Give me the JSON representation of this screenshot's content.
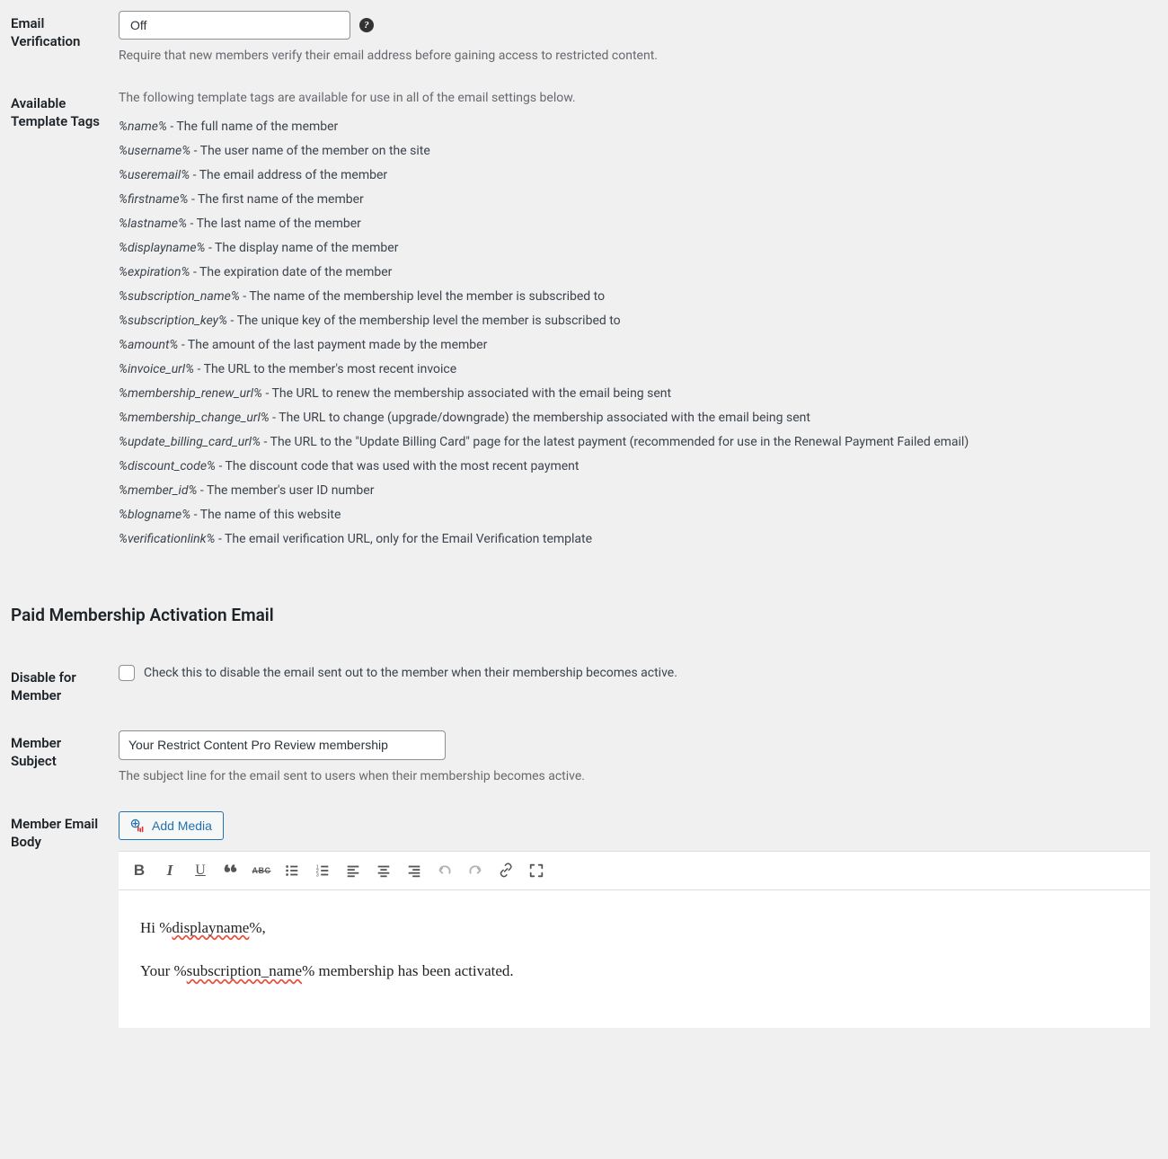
{
  "emailVerification": {
    "label": "Email Verification",
    "selected": "Off",
    "desc": "Require that new members verify their email address before gaining access to restricted content."
  },
  "templateTags": {
    "label": "Available Template Tags",
    "intro": "The following template tags are available for use in all of the email settings below.",
    "tags": [
      {
        "tag": "%name%",
        "desc": " - The full name of the member"
      },
      {
        "tag": "%username%",
        "desc": " - The user name of the member on the site"
      },
      {
        "tag": "%useremail%",
        "desc": " - The email address of the member"
      },
      {
        "tag": "%firstname%",
        "desc": " - The first name of the member"
      },
      {
        "tag": "%lastname%",
        "desc": " - The last name of the member"
      },
      {
        "tag": "%displayname%",
        "desc": " - The display name of the member"
      },
      {
        "tag": "%expiration%",
        "desc": " - The expiration date of the member"
      },
      {
        "tag": "%subscription_name%",
        "desc": " - The name of the membership level the member is subscribed to"
      },
      {
        "tag": "%subscription_key%",
        "desc": " - The unique key of the membership level the member is subscribed to"
      },
      {
        "tag": "%amount%",
        "desc": " - The amount of the last payment made by the member"
      },
      {
        "tag": "%invoice_url%",
        "desc": " - The URL to the member's most recent invoice"
      },
      {
        "tag": "%membership_renew_url%",
        "desc": " - The URL to renew the membership associated with the email being sent"
      },
      {
        "tag": "%membership_change_url%",
        "desc": " - The URL to change (upgrade/downgrade) the membership associated with the email being sent"
      },
      {
        "tag": "%update_billing_card_url%",
        "desc": " - The URL to the \"Update Billing Card\" page for the latest payment (recommended for use in the Renewal Payment Failed email)"
      },
      {
        "tag": "%discount_code%",
        "desc": " - The discount code that was used with the most recent payment"
      },
      {
        "tag": "%member_id%",
        "desc": " - The member's user ID number"
      },
      {
        "tag": "%blogname%",
        "desc": " - The name of this website"
      },
      {
        "tag": "%verificationlink%",
        "desc": " - The email verification URL, only for the Email Verification template"
      }
    ]
  },
  "sectionHeading": "Paid Membership Activation Email",
  "disableForMember": {
    "label": "Disable for Member",
    "checkboxLabel": "Check this to disable the email sent out to the member when their membership becomes active."
  },
  "memberSubject": {
    "label": "Member Subject",
    "value": "Your Restrict Content Pro Review membership",
    "desc": "The subject line for the email sent to users when their membership becomes active."
  },
  "memberEmailBody": {
    "label": "Member Email Body",
    "addMedia": "Add Media",
    "line1_pre": "Hi %",
    "line1_err": "displayname",
    "line1_post": "%,",
    "line2_pre": "Your %",
    "line2_err": "subscription_name",
    "line2_post": "% membership has been activated."
  }
}
